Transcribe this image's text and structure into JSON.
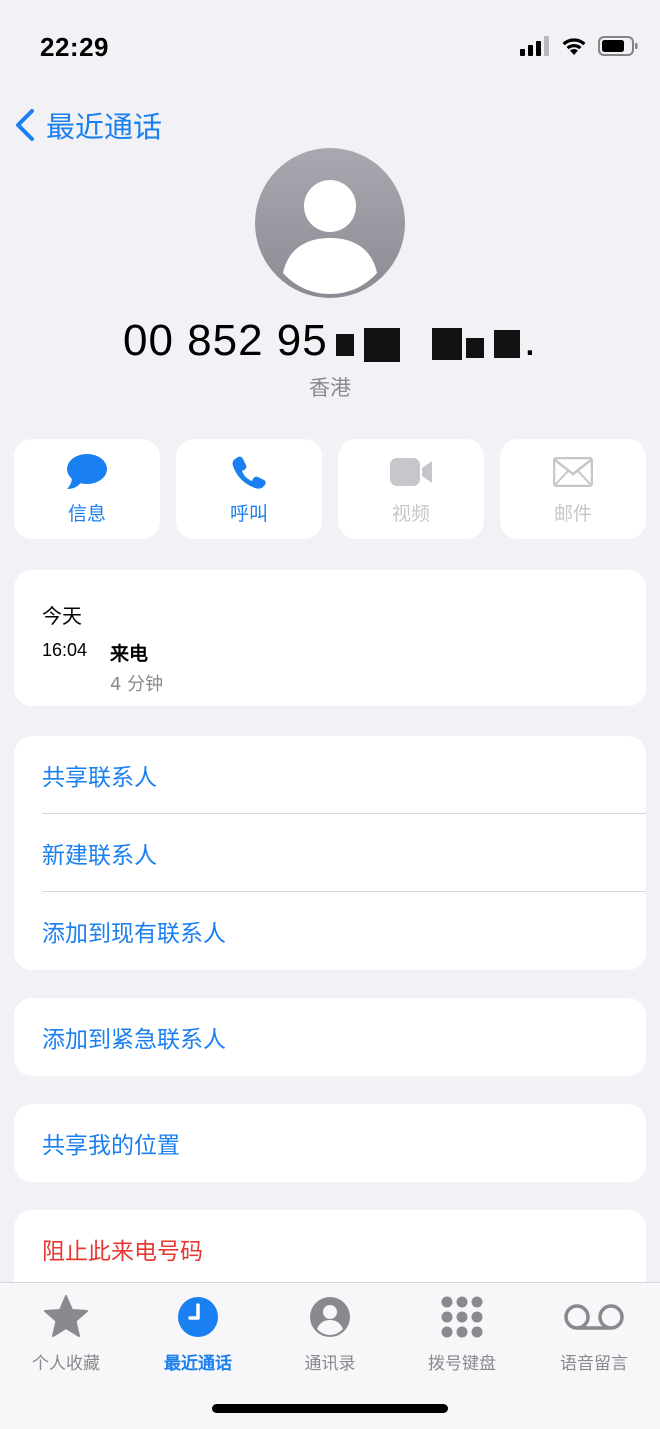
{
  "status": {
    "time": "22:29",
    "icons": [
      "cellular-signal-icon",
      "wifi-icon",
      "battery-icon"
    ]
  },
  "nav": {
    "back_label": "最近通话"
  },
  "contact": {
    "number_visible": "00 852 95",
    "number_tail": ".",
    "location": "香港"
  },
  "actions": [
    {
      "label": "信息",
      "icon": "message-bubble-icon",
      "enabled": true
    },
    {
      "label": "呼叫",
      "icon": "phone-icon",
      "enabled": true
    },
    {
      "label": "视频",
      "icon": "video-camera-icon",
      "enabled": false
    },
    {
      "label": "邮件",
      "icon": "mail-envelope-icon",
      "enabled": false
    }
  ],
  "history": {
    "day": "今天",
    "time": "16:04",
    "type": "来电",
    "duration": "4 分钟"
  },
  "options": {
    "group1": [
      "共享联系人",
      "新建联系人",
      "添加到现有联系人"
    ],
    "emergency": "添加到紧急联系人",
    "share_location": "共享我的位置",
    "block": "阻止此来电号码"
  },
  "tabs": [
    {
      "label": "个人收藏",
      "icon": "star-icon",
      "active": false
    },
    {
      "label": "最近通话",
      "icon": "clock-icon",
      "active": true
    },
    {
      "label": "通讯录",
      "icon": "contact-person-icon",
      "active": false
    },
    {
      "label": "拨号键盘",
      "icon": "keypad-icon",
      "active": false
    },
    {
      "label": "语音留言",
      "icon": "voicemail-icon",
      "active": false
    }
  ],
  "colors": {
    "accent": "#1a7ff0",
    "destructive": "#e53a33",
    "background": "#f1f1f6",
    "secondary_text": "#8a8a8e"
  }
}
